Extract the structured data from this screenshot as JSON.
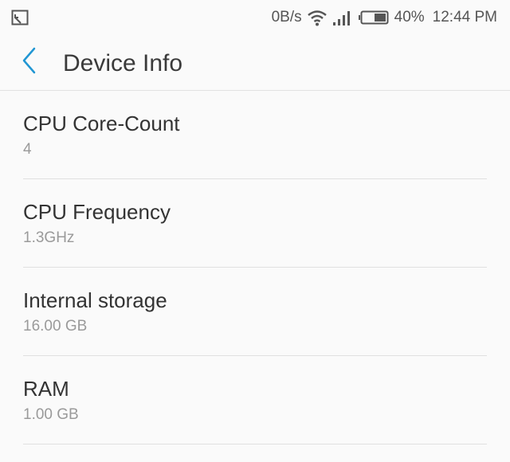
{
  "status_bar": {
    "left_icon": "screen-cast-icon",
    "network_speed": "0B/s",
    "wifi_icon": "wifi-icon",
    "signal_icon": "signal-icon",
    "battery_icon": "battery-icon",
    "battery_percent": "40%",
    "time": "12:44 PM"
  },
  "app_bar": {
    "back_icon": "chevron-left-icon",
    "title": "Device Info",
    "accent_color": "#2196d3"
  },
  "items": [
    {
      "label": "CPU Core-Count",
      "value": "4"
    },
    {
      "label": "CPU Frequency",
      "value": "1.3GHz"
    },
    {
      "label": "Internal storage",
      "value": "16.00 GB"
    },
    {
      "label": "RAM",
      "value": "1.00 GB"
    }
  ]
}
